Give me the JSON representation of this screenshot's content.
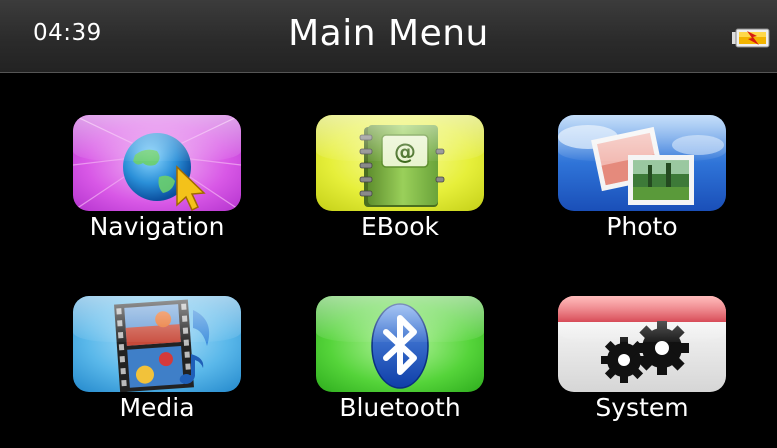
{
  "status_bar": {
    "time": "04:39",
    "title": "Main Menu",
    "battery_icon": "battery-charging-icon"
  },
  "menu": {
    "items": [
      {
        "label": "Navigation",
        "icon": "globe-cursor-icon",
        "color": "#d44fe0"
      },
      {
        "label": "EBook",
        "icon": "book-at-sign-icon",
        "color": "#e2eb2a"
      },
      {
        "label": "Photo",
        "icon": "photos-icon",
        "color": "#1e64d6"
      },
      {
        "label": "Media",
        "icon": "film-strip-icon",
        "color": "#3fa9e0"
      },
      {
        "label": "Bluetooth",
        "icon": "bluetooth-icon",
        "color": "#3fcf2a"
      },
      {
        "label": "System",
        "icon": "gears-icon",
        "color": "#e0102a"
      }
    ]
  }
}
